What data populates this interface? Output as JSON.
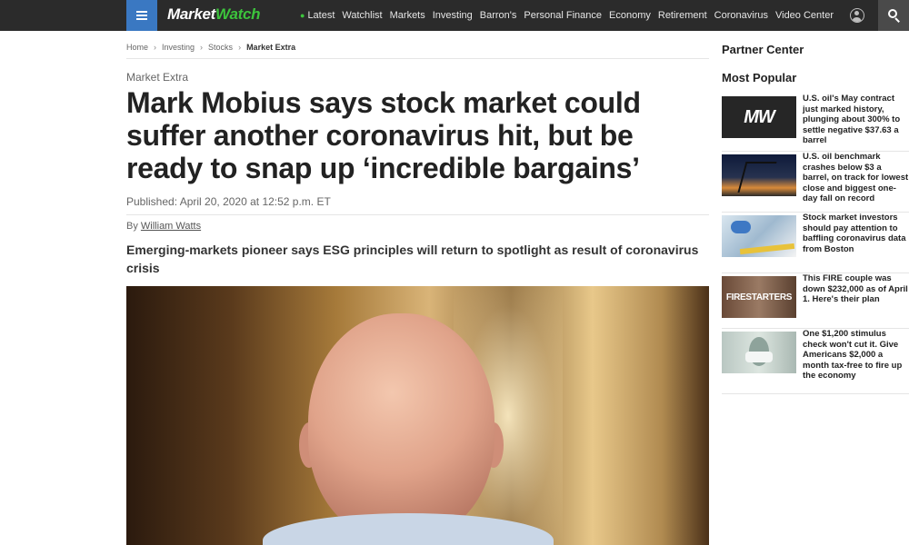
{
  "header": {
    "logo_part1": "Market",
    "logo_part2": "Watch",
    "nav": [
      "Latest",
      "Watchlist",
      "Markets",
      "Investing",
      "Barron's",
      "Personal Finance",
      "Economy",
      "Retirement",
      "Coronavirus",
      "Video Center"
    ],
    "icons": [
      "menu-icon",
      "user-icon",
      "search-icon"
    ]
  },
  "breadcrumb": [
    "Home",
    "Investing",
    "Stocks",
    "Market Extra"
  ],
  "article": {
    "kicker": "Market Extra",
    "headline": "Mark Mobius says stock market could suffer another coronavirus hit, but be ready to snap up ‘incredible bargains’",
    "published": "Published: April 20, 2020 at 12:52 p.m. ET",
    "byline_prefix": "By",
    "author": "William Watts",
    "dek": "Emerging-markets pioneer says ESG principles will return to spotlight as result of coronavirus crisis"
  },
  "sidebar": {
    "partner_center": "Partner Center",
    "most_popular": "Most Popular",
    "items": [
      {
        "text": "U.S. oil's May contract just marked history, plunging about 300% to settle negative $37.63 a barrel",
        "thumb_text": "MW"
      },
      {
        "text": "U.S. oil benchmark crashes below $3 a barrel, on track for lowest close and biggest one-day fall on record"
      },
      {
        "text": "Stock market investors should pay attention to baffling coronavirus data from Boston"
      },
      {
        "text": "This FIRE couple was down $232,000 as of April 1. Here's their plan",
        "thumb_text": "FIRESTARTERS"
      },
      {
        "text": "One $1,200 stimulus check won't cut it. Give Americans $2,000 a month tax-free to fire up the economy"
      }
    ]
  },
  "colors": {
    "topbar": "#2b2b2b",
    "menu_button": "#3a78c2",
    "brand_green": "#3cc43c"
  }
}
